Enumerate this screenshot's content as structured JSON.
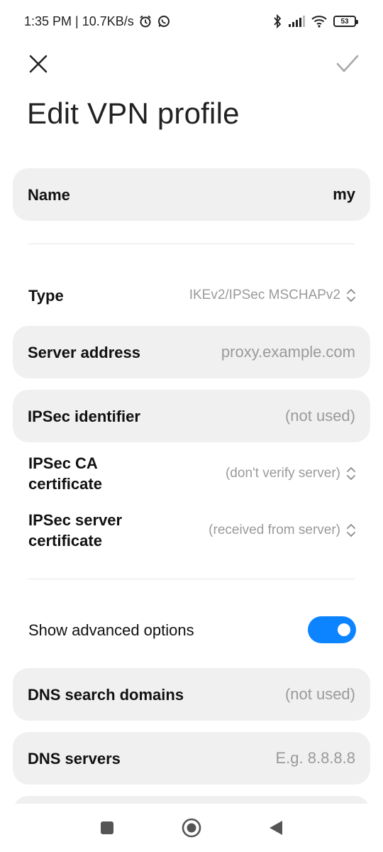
{
  "status_bar": {
    "time_speed": "1:35 PM | 10.7KB/s",
    "battery": "53",
    "icons": [
      "alarm-icon",
      "whatsapp-icon",
      "bluetooth-icon",
      "signal-icon",
      "wifi-icon",
      "battery-icon"
    ]
  },
  "toolbar": {
    "close_icon": "close-icon",
    "confirm_icon": "check-icon"
  },
  "page": {
    "title": "Edit VPN profile"
  },
  "fields": {
    "name": {
      "label": "Name",
      "value": "my"
    },
    "type": {
      "label": "Type",
      "value": "IKEv2/IPSec MSCHAPv2"
    },
    "server_address": {
      "label": "Server address",
      "placeholder": "proxy.example.com"
    },
    "ipsec_identifier": {
      "label": "IPSec identifier",
      "placeholder": "(not used)"
    },
    "ipsec_ca_certificate": {
      "label_line1": "IPSec CA",
      "label_line2": "certificate",
      "value": "(don't verify server)"
    },
    "ipsec_server_certificate": {
      "label_line1": "IPSec server",
      "label_line2": "certificate",
      "value": "(received from server)"
    },
    "show_advanced": {
      "label": "Show advanced options",
      "enabled": true
    },
    "dns_search_domains": {
      "label": "DNS search domains",
      "placeholder": "(not used)"
    },
    "dns_servers": {
      "label": "DNS servers",
      "placeholder": "E.g. 8.8.8.8"
    }
  },
  "colors": {
    "accent": "#0d84ff",
    "card_bg": "#f0f0f0",
    "muted_text": "#9a9a9a"
  },
  "nav": {
    "icons": [
      "recents-square-icon",
      "home-circle-icon",
      "back-triangle-icon"
    ]
  }
}
